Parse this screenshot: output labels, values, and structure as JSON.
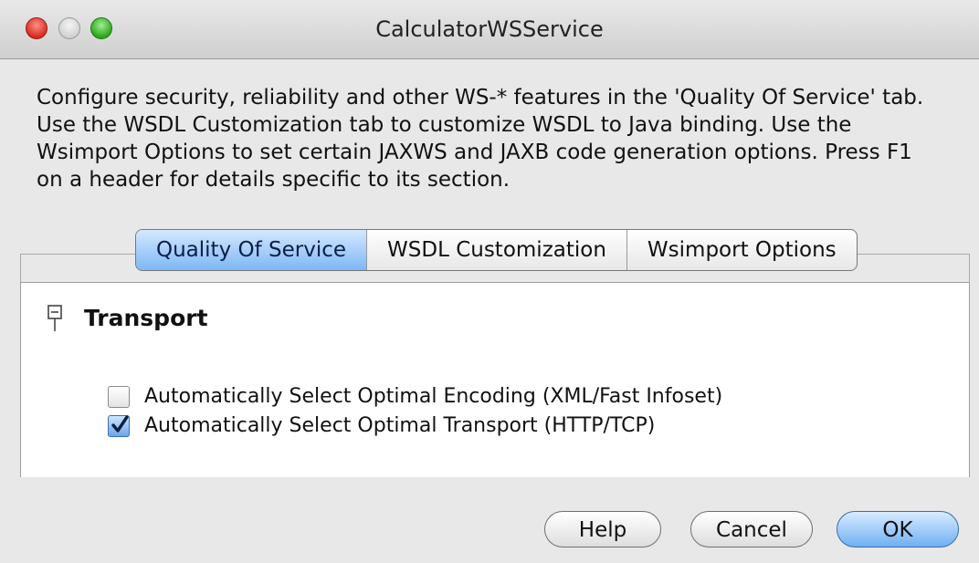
{
  "window": {
    "title": "CalculatorWSService"
  },
  "description": {
    "lines": [
      "Configure security, reliability and other WS-* features in the 'Quality Of Service' tab.",
      "Use the WSDL Customization tab to customize WSDL to Java binding. Use the",
      "Wsimport Options to set certain JAXWS and JAXB code generation options. Press F1",
      "on a header for details specific to its section."
    ]
  },
  "tabs": [
    {
      "label": "Quality Of Service",
      "selected": true
    },
    {
      "label": "WSDL Customization",
      "selected": false
    },
    {
      "label": "Wsimport Options",
      "selected": false
    }
  ],
  "panel": {
    "section_title": "Transport",
    "section_icon": "collapse-icon",
    "options": [
      {
        "label": "Automatically Select Optimal Encoding (XML/Fast Infoset)",
        "checked": false
      },
      {
        "label": "Automatically Select Optimal Transport (HTTP/TCP)",
        "checked": true
      }
    ]
  },
  "buttons": {
    "help": "Help",
    "cancel": "Cancel",
    "ok": "OK"
  }
}
